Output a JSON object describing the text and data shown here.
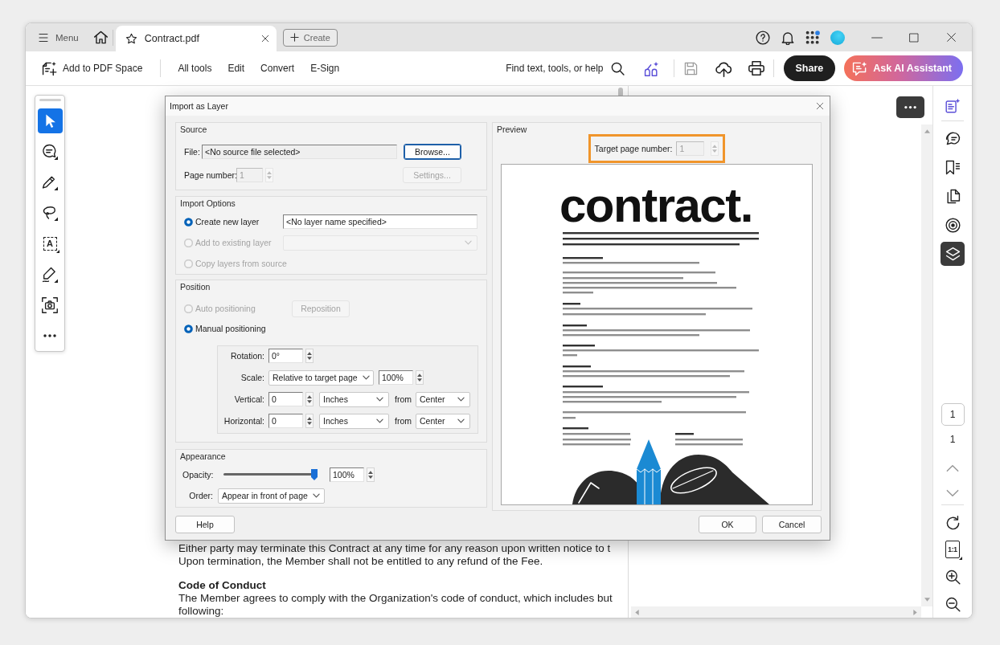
{
  "titlebar": {
    "menu": "Menu",
    "tabs": [
      {
        "title": "Contract.pdf",
        "selected": true
      }
    ],
    "create": "Create"
  },
  "toolbar": {
    "add_to_space": "Add to PDF Space",
    "menus": [
      "All tools",
      "Edit",
      "Convert",
      "E-Sign"
    ],
    "search": "Find text, tools, or help",
    "share": "Share",
    "assistant": "Ask AI Assistant"
  },
  "tool_rail": [
    {
      "selected": true
    },
    {
      "selected": false
    },
    {
      "selected": false
    },
    {
      "selected": false
    },
    {
      "glyph": "A",
      "selected": false
    },
    {
      "selected": false
    },
    {
      "selected": false
    }
  ],
  "document": {
    "sections": [
      {
        "lines": [
          "Either party may terminate this Contract at any time for any reason upon written notice to t",
          "Upon termination, the Member shall not be entitled to any refund of the Fee."
        ]
      },
      {
        "title": "Code of Conduct",
        "lines": [
          "The Member agrees to comply with the Organization's code of conduct, which includes but",
          "following:"
        ]
      }
    ]
  },
  "right_rail": {
    "tools": [
      {
        "selected": false
      },
      {
        "selected": false
      },
      {
        "selected": false
      },
      {
        "selected": false
      },
      {
        "selected": false
      },
      {
        "selected": true
      }
    ],
    "page_field": "1",
    "page_count": "1",
    "fit_glyph": "1:1"
  },
  "dialog": {
    "title": "Import as Layer",
    "source": {
      "title": "Source",
      "file": {
        "label": "File:",
        "value": "<No source file selected>"
      },
      "browse": {
        "label": "Browse...",
        "focused": true
      },
      "page": {
        "label": "Page number:",
        "value": "1",
        "disabled": true
      },
      "settings": {
        "label": "Settings...",
        "disabled": true
      }
    },
    "import_options": {
      "title": "Import Options",
      "options": [
        {
          "label": "Create new layer",
          "selected": true,
          "disabled": false,
          "field": {
            "kind": "text",
            "value": "<No layer name specified>",
            "disabled": false
          }
        },
        {
          "label": "Add to existing layer",
          "selected": false,
          "disabled": true,
          "field": {
            "kind": "dropdown",
            "disabled": true
          }
        },
        {
          "label": "Copy layers from source",
          "selected": false,
          "disabled": true
        }
      ]
    },
    "position": {
      "title": "Position",
      "options": [
        {
          "label": "Auto positioning",
          "selected": false,
          "disabled": true,
          "button": {
            "label": "Reposition",
            "disabled": true
          }
        },
        {
          "label": "Manual positioning",
          "selected": true,
          "disabled": false
        }
      ],
      "rows": [
        {
          "kind": "rotation",
          "label": "Rotation:",
          "value": "0°"
        },
        {
          "kind": "scale",
          "label": "Scale:",
          "mode": "Relative to target page",
          "value": "100%"
        },
        {
          "kind": "offset",
          "label": "Vertical:",
          "value": "0",
          "unit": "Inches",
          "from": "from",
          "anchor": "Center"
        },
        {
          "kind": "offset",
          "label": "Horizontal:",
          "value": "0",
          "unit": "Inches",
          "from": "from",
          "anchor": "Center"
        }
      ]
    },
    "appearance": {
      "title": "Appearance",
      "opacity": {
        "label": "Opacity:",
        "level": 1,
        "value": "100%"
      },
      "order": {
        "label": "Order:",
        "value": "Appear in front of page"
      }
    },
    "preview": {
      "title": "Preview",
      "target": {
        "label": "Target page number:",
        "value": "1",
        "disabled": true,
        "highlighted": true
      },
      "page": {
        "heading": "contract."
      }
    },
    "help": "Help",
    "buttons": [
      "OK",
      "Cancel"
    ]
  }
}
